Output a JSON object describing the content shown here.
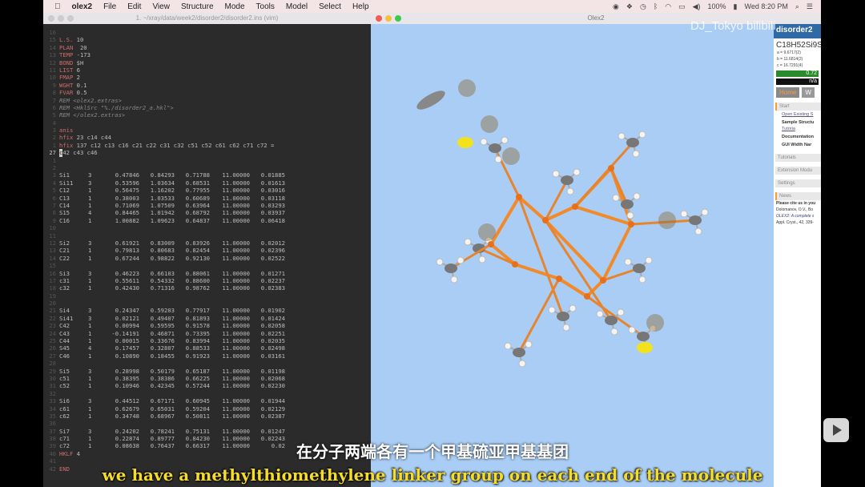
{
  "menubar": {
    "app": "olex2",
    "items": [
      "File",
      "Edit",
      "View",
      "Structure",
      "Mode",
      "Tools",
      "Model",
      "Select",
      "Help"
    ],
    "battery": "100%",
    "clock": "Wed 8:20 PM"
  },
  "vim": {
    "title": "1. ~/xray/data/week2/disorder2/disorder2.ins  (vim)",
    "current_line": 16,
    "rows": [
      {
        "t": "blank"
      },
      {
        "t": "kw",
        "kw": "L.S.",
        "rest": " 10"
      },
      {
        "t": "kw",
        "kw": "PLAN",
        "rest": "  20"
      },
      {
        "t": "kw",
        "kw": "TEMP",
        "rest": " -173"
      },
      {
        "t": "kw",
        "kw": "BOND",
        "rest": " $H"
      },
      {
        "t": "kw",
        "kw": "LIST",
        "rest": " 6"
      },
      {
        "t": "kw",
        "kw": "FMAP",
        "rest": " 2"
      },
      {
        "t": "kw",
        "kw": "WGHT",
        "rest": " 0.1"
      },
      {
        "t": "kw",
        "kw": "FVAR",
        "rest": " 0.5"
      },
      {
        "t": "rem",
        "kw": "REM",
        "rest": " <olex2.extras>"
      },
      {
        "t": "rem",
        "kw": "REM",
        "rest": " <HklSrc \"%./disorder2_a.hkl\">"
      },
      {
        "t": "rem",
        "kw": "REM",
        "rest": " </olex2.extras>"
      },
      {
        "t": "blank"
      },
      {
        "t": "kw",
        "kw": "anis",
        "rest": ""
      },
      {
        "t": "kw",
        "kw": "hfix",
        "rest": " 23 c14 c44"
      },
      {
        "t": "kw",
        "kw": "hfix",
        "rest": " 137 c12 c13 c16 c21 c22 c31 c32 c51 c52 c61 c62 c71 c72 ="
      },
      {
        "t": "cur",
        "kw": "c",
        "rest": "42 c43 c46"
      },
      {
        "t": "blank"
      },
      {
        "t": "blank"
      },
      {
        "t": "atom",
        "a": [
          "Si1",
          "3",
          "0.47846",
          "0.84293",
          "0.71788",
          "11.00000",
          "0.01885"
        ]
      },
      {
        "t": "atom",
        "a": [
          "Si11",
          "3",
          "0.53596",
          "1.03634",
          "0.68531",
          "11.00000",
          "0.01613"
        ]
      },
      {
        "t": "atom",
        "a": [
          "C12",
          "1",
          "0.56475",
          "1.16202",
          "0.77955",
          "11.00000",
          "0.03016"
        ]
      },
      {
        "t": "atom",
        "a": [
          "C13",
          "1",
          "0.38003",
          "1.03533",
          "0.60689",
          "11.00000",
          "0.03118"
        ]
      },
      {
        "t": "atom",
        "a": [
          "C14",
          "1",
          "0.71069",
          "1.07509",
          "0.63964",
          "11.00000",
          "0.03293"
        ]
      },
      {
        "t": "atom",
        "a": [
          "S15",
          "4",
          "0.84465",
          "1.01942",
          "0.68792",
          "11.00000",
          "0.03937"
        ]
      },
      {
        "t": "atom",
        "a": [
          "C16",
          "1",
          "1.00882",
          "1.09623",
          "0.64837",
          "11.00000",
          "0.06418"
        ]
      },
      {
        "t": "blank"
      },
      {
        "t": "blank"
      },
      {
        "t": "atom",
        "a": [
          "Si2",
          "3",
          "0.61921",
          "0.83009",
          "0.83926",
          "11.00000",
          "0.02012"
        ]
      },
      {
        "t": "atom",
        "a": [
          "C21",
          "1",
          "0.79813",
          "0.80683",
          "0.82454",
          "11.00000",
          "0.02396"
        ]
      },
      {
        "t": "atom",
        "a": [
          "C22",
          "1",
          "0.67244",
          "0.98822",
          "0.92130",
          "11.00000",
          "0.02522"
        ]
      },
      {
        "t": "blank"
      },
      {
        "t": "atom",
        "a": [
          "Si3",
          "3",
          "0.46223",
          "0.66103",
          "0.88061",
          "11.00000",
          "0.01271"
        ]
      },
      {
        "t": "atom",
        "a": [
          "c31",
          "1",
          "0.55611",
          "0.54332",
          "0.88600",
          "11.00000",
          "0.02237"
        ]
      },
      {
        "t": "atom",
        "a": [
          "c32",
          "1",
          "0.42430",
          "0.71316",
          "0.98762",
          "11.00000",
          "0.02383"
        ]
      },
      {
        "t": "blank"
      },
      {
        "t": "blank"
      },
      {
        "t": "atom",
        "a": [
          "Si4",
          "3",
          "0.24347",
          "0.59203",
          "0.77917",
          "11.00000",
          "0.01902"
        ]
      },
      {
        "t": "atom",
        "a": [
          "Si41",
          "3",
          "0.02121",
          "0.49407",
          "0.81893",
          "11.00000",
          "0.01424"
        ]
      },
      {
        "t": "atom",
        "a": [
          "C42",
          "1",
          "0.00994",
          "0.59595",
          "0.91578",
          "11.00000",
          "0.02058"
        ]
      },
      {
        "t": "atom",
        "a": [
          "C43",
          "1",
          "-0.14191",
          "0.46871",
          "0.73395",
          "11.00000",
          "0.02251"
        ]
      },
      {
        "t": "atom",
        "a": [
          "C44",
          "1",
          "0.00015",
          "0.33676",
          "0.83994",
          "11.00000",
          "0.02035"
        ]
      },
      {
        "t": "atom",
        "a": [
          "S45",
          "4",
          "0.17457",
          "0.32807",
          "0.88533",
          "11.00000",
          "0.02498"
        ]
      },
      {
        "t": "atom",
        "a": [
          "C46",
          "1",
          "0.10890",
          "0.18455",
          "0.91923",
          "11.00000",
          "0.03161"
        ]
      },
      {
        "t": "blank"
      },
      {
        "t": "atom",
        "a": [
          "Si5",
          "3",
          "0.28998",
          "0.50179",
          "0.65187",
          "11.00000",
          "0.01198"
        ]
      },
      {
        "t": "atom",
        "a": [
          "c51",
          "1",
          "0.38395",
          "0.38386",
          "0.66225",
          "11.00000",
          "0.02068"
        ]
      },
      {
        "t": "atom",
        "a": [
          "c52",
          "1",
          "0.10946",
          "0.42345",
          "0.57244",
          "11.00000",
          "0.02230"
        ]
      },
      {
        "t": "blank"
      },
      {
        "t": "atom",
        "a": [
          "Si6",
          "3",
          "0.44512",
          "0.67171",
          "0.60945",
          "11.00000",
          "0.01944"
        ]
      },
      {
        "t": "atom",
        "a": [
          "c61",
          "1",
          "0.62679",
          "0.65031",
          "0.59204",
          "11.00000",
          "0.02129"
        ]
      },
      {
        "t": "atom",
        "a": [
          "c62",
          "1",
          "0.34748",
          "0.68967",
          "0.50811",
          "11.00000",
          "0.02387"
        ]
      },
      {
        "t": "blank"
      },
      {
        "t": "atom",
        "a": [
          "Si7",
          "3",
          "0.24202",
          "0.78241",
          "0.75131",
          "11.00000",
          "0.01247"
        ]
      },
      {
        "t": "atom",
        "a": [
          "c71",
          "1",
          "0.22874",
          "0.89777",
          "0.84230",
          "11.00000",
          "0.02243"
        ]
      },
      {
        "t": "atom",
        "a": [
          "c72",
          "1",
          "0.08638",
          "0.76437",
          "0.66317",
          "11.00000",
          "0.02"
        ]
      },
      {
        "t": "kw",
        "kw": "HKLF",
        "rest": " 4"
      },
      {
        "t": "blank"
      },
      {
        "t": "kw",
        "kw": "END",
        "rest": ""
      }
    ]
  },
  "olex": {
    "title": "Olex2",
    "panel": {
      "name": "disorder2",
      "formula": "C18H52Si9S",
      "cell": [
        "a = 9.6717(2)",
        "b = 11.6814(2)",
        "c = 16.7291(4)"
      ],
      "r_value": "0.72",
      "r2_value": "n/a",
      "tabs": [
        "Home",
        "W"
      ],
      "start": "Start",
      "start_items": [
        "Open Existing S",
        "Sample Structu",
        "Documentation",
        "GUI Width  Nar"
      ],
      "sample_link": "Tutoria",
      "sections": [
        "Tutorials",
        "Extension Modu",
        "Settings"
      ],
      "news": "News",
      "news_lines": [
        "Please cite us in you",
        "Dolomanov, O.V., Bo",
        "OLEX2: A complete s",
        "Appl. Cryst., 42, 339-"
      ]
    }
  },
  "overlay": {
    "watermark": "DJ_Tokyo bilibili",
    "subtitle_cn": "在分子两端各有一个甲基硫亚甲基基团",
    "subtitle_en": "we have a methylthiomethylene linker group on each end of the molecule"
  }
}
